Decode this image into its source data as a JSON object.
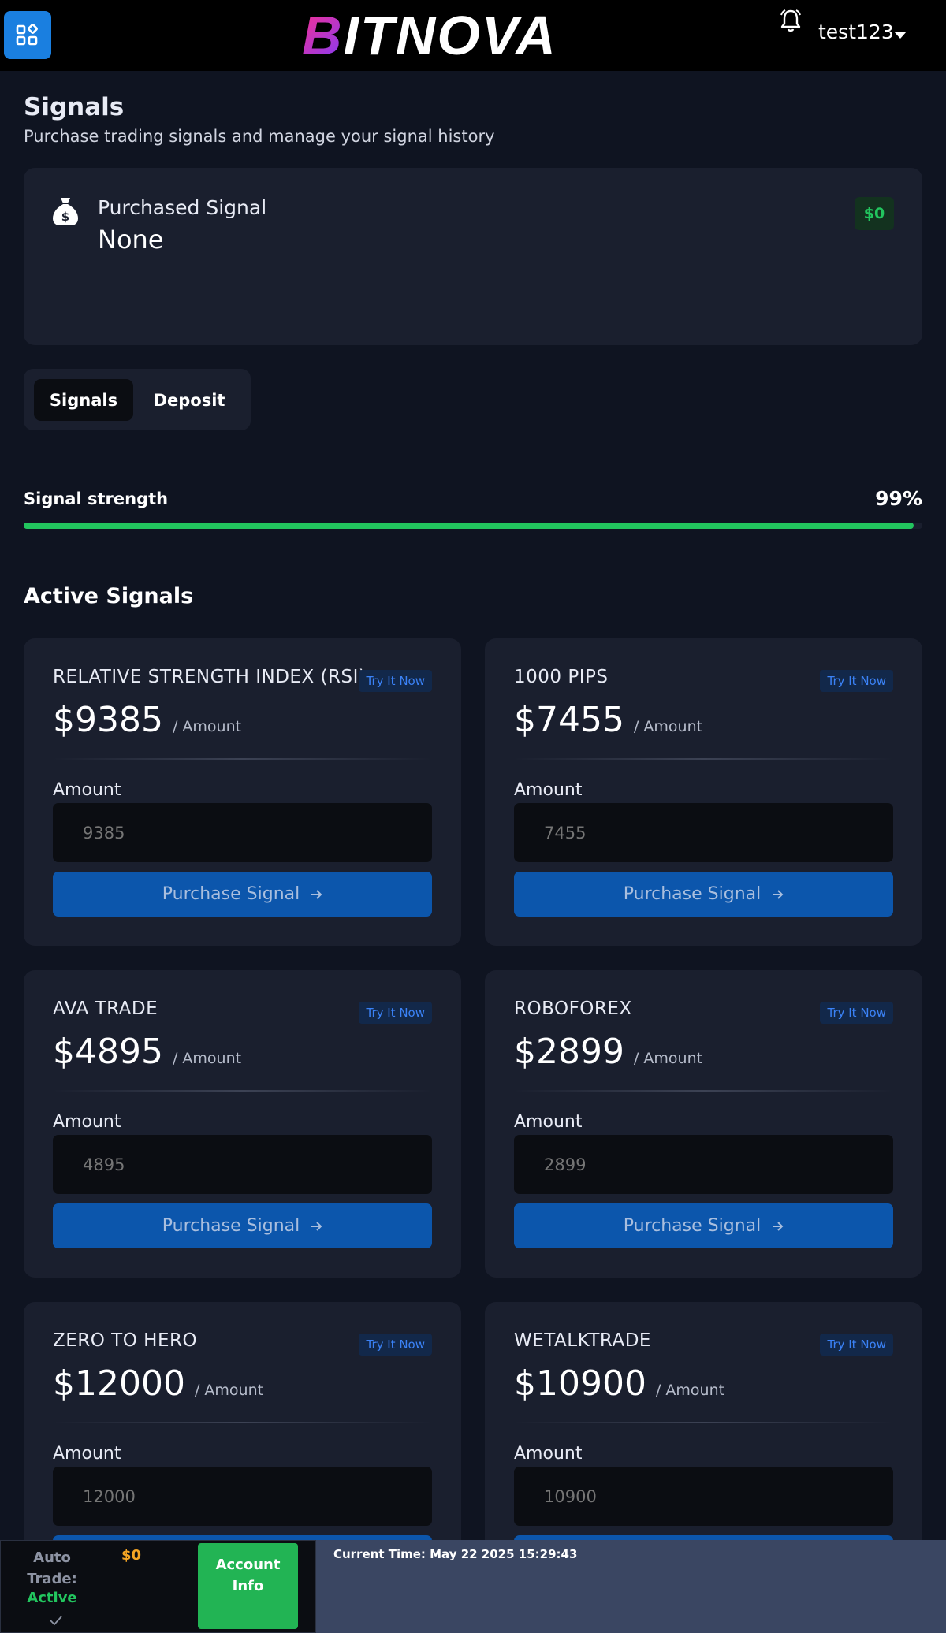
{
  "header": {
    "brand_letter": "B",
    "brand_rest": "ITNOVA",
    "username": "test123",
    "icons": [
      "grid-menu-icon",
      "bell-icon",
      "chevron-down-icon"
    ]
  },
  "page": {
    "title": "Signals",
    "subtitle": "Purchase trading signals and manage your signal history"
  },
  "purchased": {
    "label": "Purchased Signal",
    "value": "None",
    "amount": "$0"
  },
  "tabs": [
    {
      "label": "Signals",
      "active": true
    },
    {
      "label": "Deposit",
      "active": false
    }
  ],
  "strength": {
    "label": "Signal strength",
    "value_text": "99%",
    "percent": 99
  },
  "active_section": {
    "title": "Active Signals"
  },
  "card_common": {
    "try_label": "Try It Now",
    "unit": "/ Amount",
    "amount_label": "Amount",
    "button_label": "Purchase Signal",
    "button_icon": "arrow-right-icon"
  },
  "signals": [
    {
      "name": "RELATIVE STRENGTH INDEX (RSI)",
      "price": "$9385",
      "amount": "9385"
    },
    {
      "name": "1000 PIPS",
      "price": "$7455",
      "amount": "7455"
    },
    {
      "name": "AVA TRADE",
      "price": "$4895",
      "amount": "4895"
    },
    {
      "name": "ROBOFOREX",
      "price": "$2899",
      "amount": "2899"
    },
    {
      "name": "ZERO TO HERO",
      "price": "$12000",
      "amount": "12000"
    },
    {
      "name": "WETALKTRADE",
      "price": "$10900",
      "amount": "10900"
    }
  ],
  "footer": {
    "auto_label": "Auto Trade:",
    "auto_status": "Active",
    "balance": "$0",
    "account_button": "Account Info",
    "current_time": "Current Time: May 22 2025 15:29:43"
  },
  "colors": {
    "accent": "#1a7fe0",
    "success": "#22c55e",
    "balance": "#f5a524",
    "card": "#1a1f2e",
    "background": "#0f1421"
  }
}
